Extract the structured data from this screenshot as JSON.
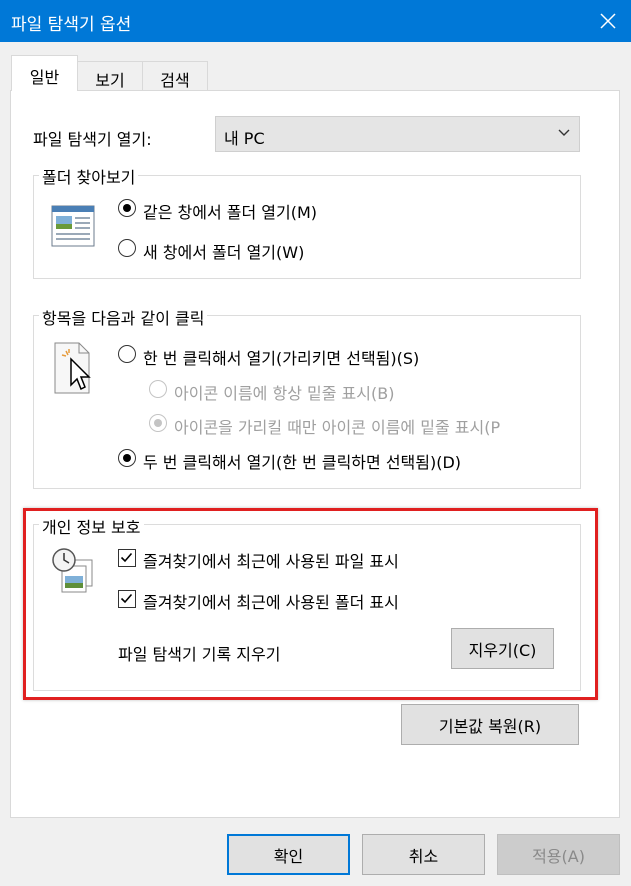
{
  "window": {
    "title": "파일 탐색기 옵션"
  },
  "tabs": [
    {
      "label": "일반",
      "active": true
    },
    {
      "label": "보기",
      "active": false
    },
    {
      "label": "검색",
      "active": false
    }
  ],
  "general": {
    "open_label": "파일 탐색기 열기:",
    "open_value": "내 PC",
    "browse_group": {
      "legend": "폴더 찾아보기",
      "options": [
        {
          "label": "같은 창에서 폴더 열기(M)",
          "checked": true
        },
        {
          "label": "새 창에서 폴더 열기(W)",
          "checked": false
        }
      ]
    },
    "click_group": {
      "legend": "항목을 다음과 같이 클릭",
      "options": [
        {
          "label": "한 번 클릭해서 열기(가리키면 선택됨)(S)",
          "checked": false
        },
        {
          "label": "아이콘 이름에 항상 밑줄 표시(B)",
          "checked": false,
          "disabled": true
        },
        {
          "label": "아이콘을 가리킬 때만 아이콘 이름에 밑줄 표시(P",
          "checked": true,
          "disabled": true
        },
        {
          "label": "두 번 클릭해서 열기(한 번 클릭하면 선택됨)(D)",
          "checked": true
        }
      ]
    },
    "privacy_group": {
      "legend": "개인 정보 보호",
      "checks": [
        {
          "label": "즐겨찾기에서 최근에 사용된 파일 표시",
          "checked": true
        },
        {
          "label": "즐겨찾기에서 최근에 사용된 폴더 표시",
          "checked": true
        }
      ],
      "clear_label": "파일 탐색기 기록 지우기",
      "clear_button": "지우기(C)"
    },
    "restore_button": "기본값 복원(R)"
  },
  "footer": {
    "ok": "확인",
    "cancel": "취소",
    "apply": "적용(A)"
  },
  "colors": {
    "titlebar": "#0078d7",
    "highlight": "#e02020"
  }
}
